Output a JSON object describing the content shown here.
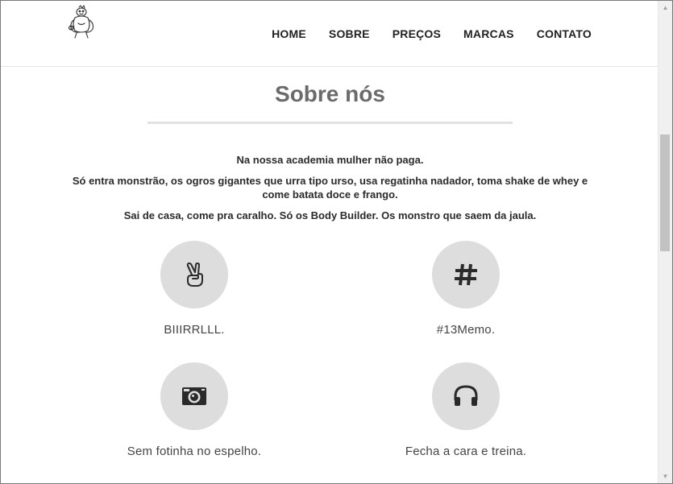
{
  "nav": {
    "items": [
      {
        "label": "HOME"
      },
      {
        "label": "SOBRE"
      },
      {
        "label": "PREÇOS"
      },
      {
        "label": "MARCAS"
      },
      {
        "label": "CONTATO"
      }
    ]
  },
  "about": {
    "title": "Sobre nós",
    "paragraphs": [
      "Na nossa academia mulher não paga.",
      "Só entra monstrão, os ogros gigantes que urra tipo urso, usa regatinha nadador, toma shake de whey e come batata doce e frango.",
      "Sai de casa, come pra caralho. Só os Body Builder. Os monstro que saem da jaula."
    ],
    "features": [
      {
        "icon": "peace-hand-icon",
        "label": "BIIIRRLLL."
      },
      {
        "icon": "hashtag-icon",
        "label": "#13Memo."
      },
      {
        "icon": "camera-icon",
        "label": "Sem fotinha no espelho."
      },
      {
        "icon": "headphones-icon",
        "label": "Fecha a cara e treina."
      }
    ]
  },
  "colors": {
    "icon_circle": "#dddddd",
    "icon": "#2a2a2a",
    "title": "#6b6b6b"
  }
}
